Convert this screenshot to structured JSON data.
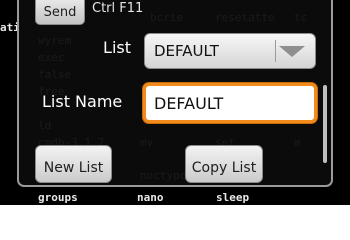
{
  "toolbar": {
    "send_label": "Send",
    "shortcut": "Ctrl F11"
  },
  "form": {
    "list_label": "List",
    "list_value": "DEFAULT",
    "list_name_label": "List Name",
    "list_name_value": "DEFAULT"
  },
  "actions": {
    "new_list_label": "New List",
    "copy_list_label": "Copy List"
  },
  "terminal": {
    "words": [
      "ati",
      "groups",
      "nano",
      "sleep"
    ]
  }
}
